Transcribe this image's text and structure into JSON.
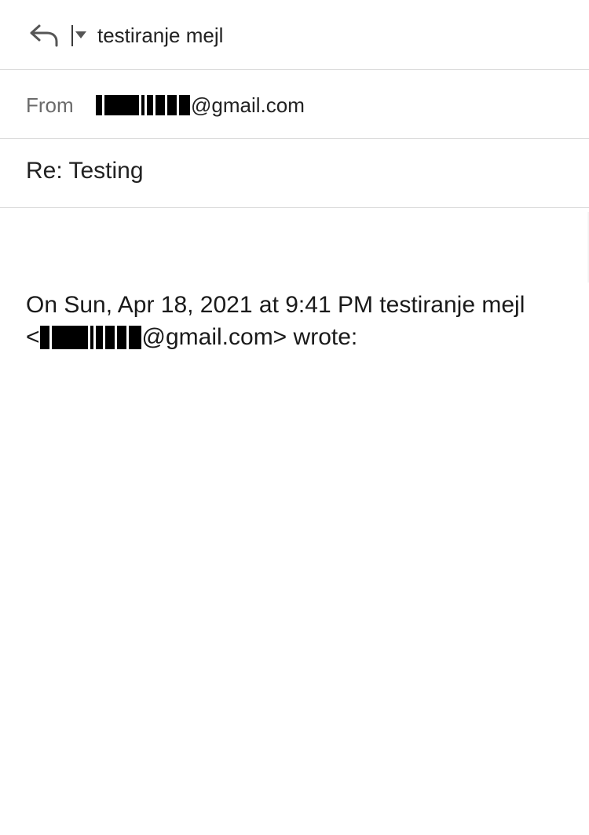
{
  "header": {
    "reply_icon": "reply-arrow-icon",
    "dropdown_icon": "caret-down-icon",
    "to_name": "testiranje mejl"
  },
  "from_row": {
    "label": "From",
    "address_domain": "@gmail.com"
  },
  "subject_row": {
    "subject": "Re: Testing"
  },
  "body": {
    "quote_header_line1": "On Sun, Apr 18, 2021 at 9:41 PM testiranje mejl",
    "quote_open": "<",
    "quote_domain_close": "@gmail.com> wrote:"
  },
  "colors": {
    "divider": "#dcdcdc",
    "label_gray": "#6b6b6b",
    "text": "#222222",
    "redaction": "#000000"
  }
}
